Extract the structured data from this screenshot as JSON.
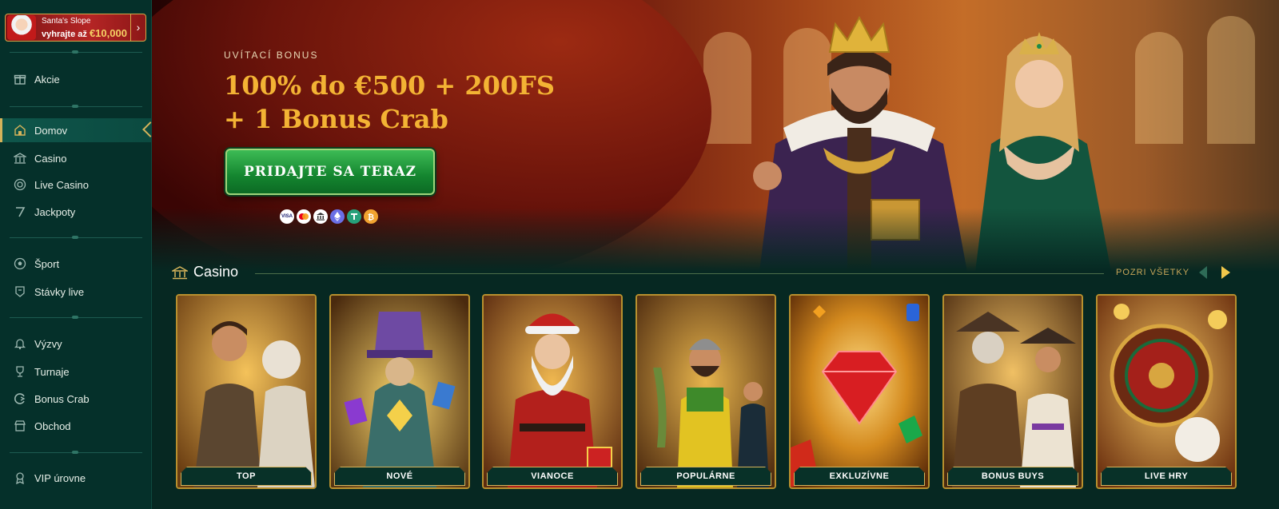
{
  "promo": {
    "title": "Santa's Slope",
    "prefix": "vyhrajte až",
    "amount": "€10,000",
    "icon": "chevron-right-icon"
  },
  "sidebar": {
    "items": [
      {
        "label": "Akcie",
        "icon": "gift-icon",
        "active": false
      },
      {
        "label": "Domov",
        "icon": "home-icon",
        "active": true
      },
      {
        "label": "Casino",
        "icon": "casino-icon",
        "active": false
      },
      {
        "label": "Live Casino",
        "icon": "live-casino-icon",
        "active": false
      },
      {
        "label": "Jackpoty",
        "icon": "jackpot-icon",
        "active": false
      },
      {
        "label": "Šport",
        "icon": "soccer-ball-icon",
        "active": false
      },
      {
        "label": "Stávky live",
        "icon": "live-bets-icon",
        "active": false
      },
      {
        "label": "Výzvy",
        "icon": "bell-icon",
        "active": false
      },
      {
        "label": "Turnaje",
        "icon": "trophy-icon",
        "active": false
      },
      {
        "label": "Bonus Crab",
        "icon": "crab-claw-icon",
        "active": false
      },
      {
        "label": "Obchod",
        "icon": "shop-icon",
        "active": false
      },
      {
        "label": "VIP úrovne",
        "icon": "vip-badge-icon",
        "active": false
      }
    ]
  },
  "hero": {
    "eyebrow": "UVÍTACÍ BONUS",
    "headline_line1": "100% do €500 + 200FS",
    "headline_line2": "+ 1 Bonus Crab",
    "cta": "PRIDAJTE SA TERAZ",
    "payments": [
      "VISA",
      "mastercard",
      "bank",
      "ethereum",
      "tether",
      "bitcoin"
    ]
  },
  "casino": {
    "title": "Casino",
    "see_all": "POZRI VŠETKY",
    "categories": [
      "TOP",
      "NOVÉ",
      "VIANOCE",
      "POPULÁRNE",
      "EXKLUZÍVNE",
      "BONUS BUYS",
      "LIVE HRY"
    ]
  },
  "colors": {
    "sidebar_bg": "#05302a",
    "page_bg": "#062822",
    "accent_gold": "#d5b35a",
    "headline_gold": "#f3b334",
    "cta_green": "#14852f"
  }
}
